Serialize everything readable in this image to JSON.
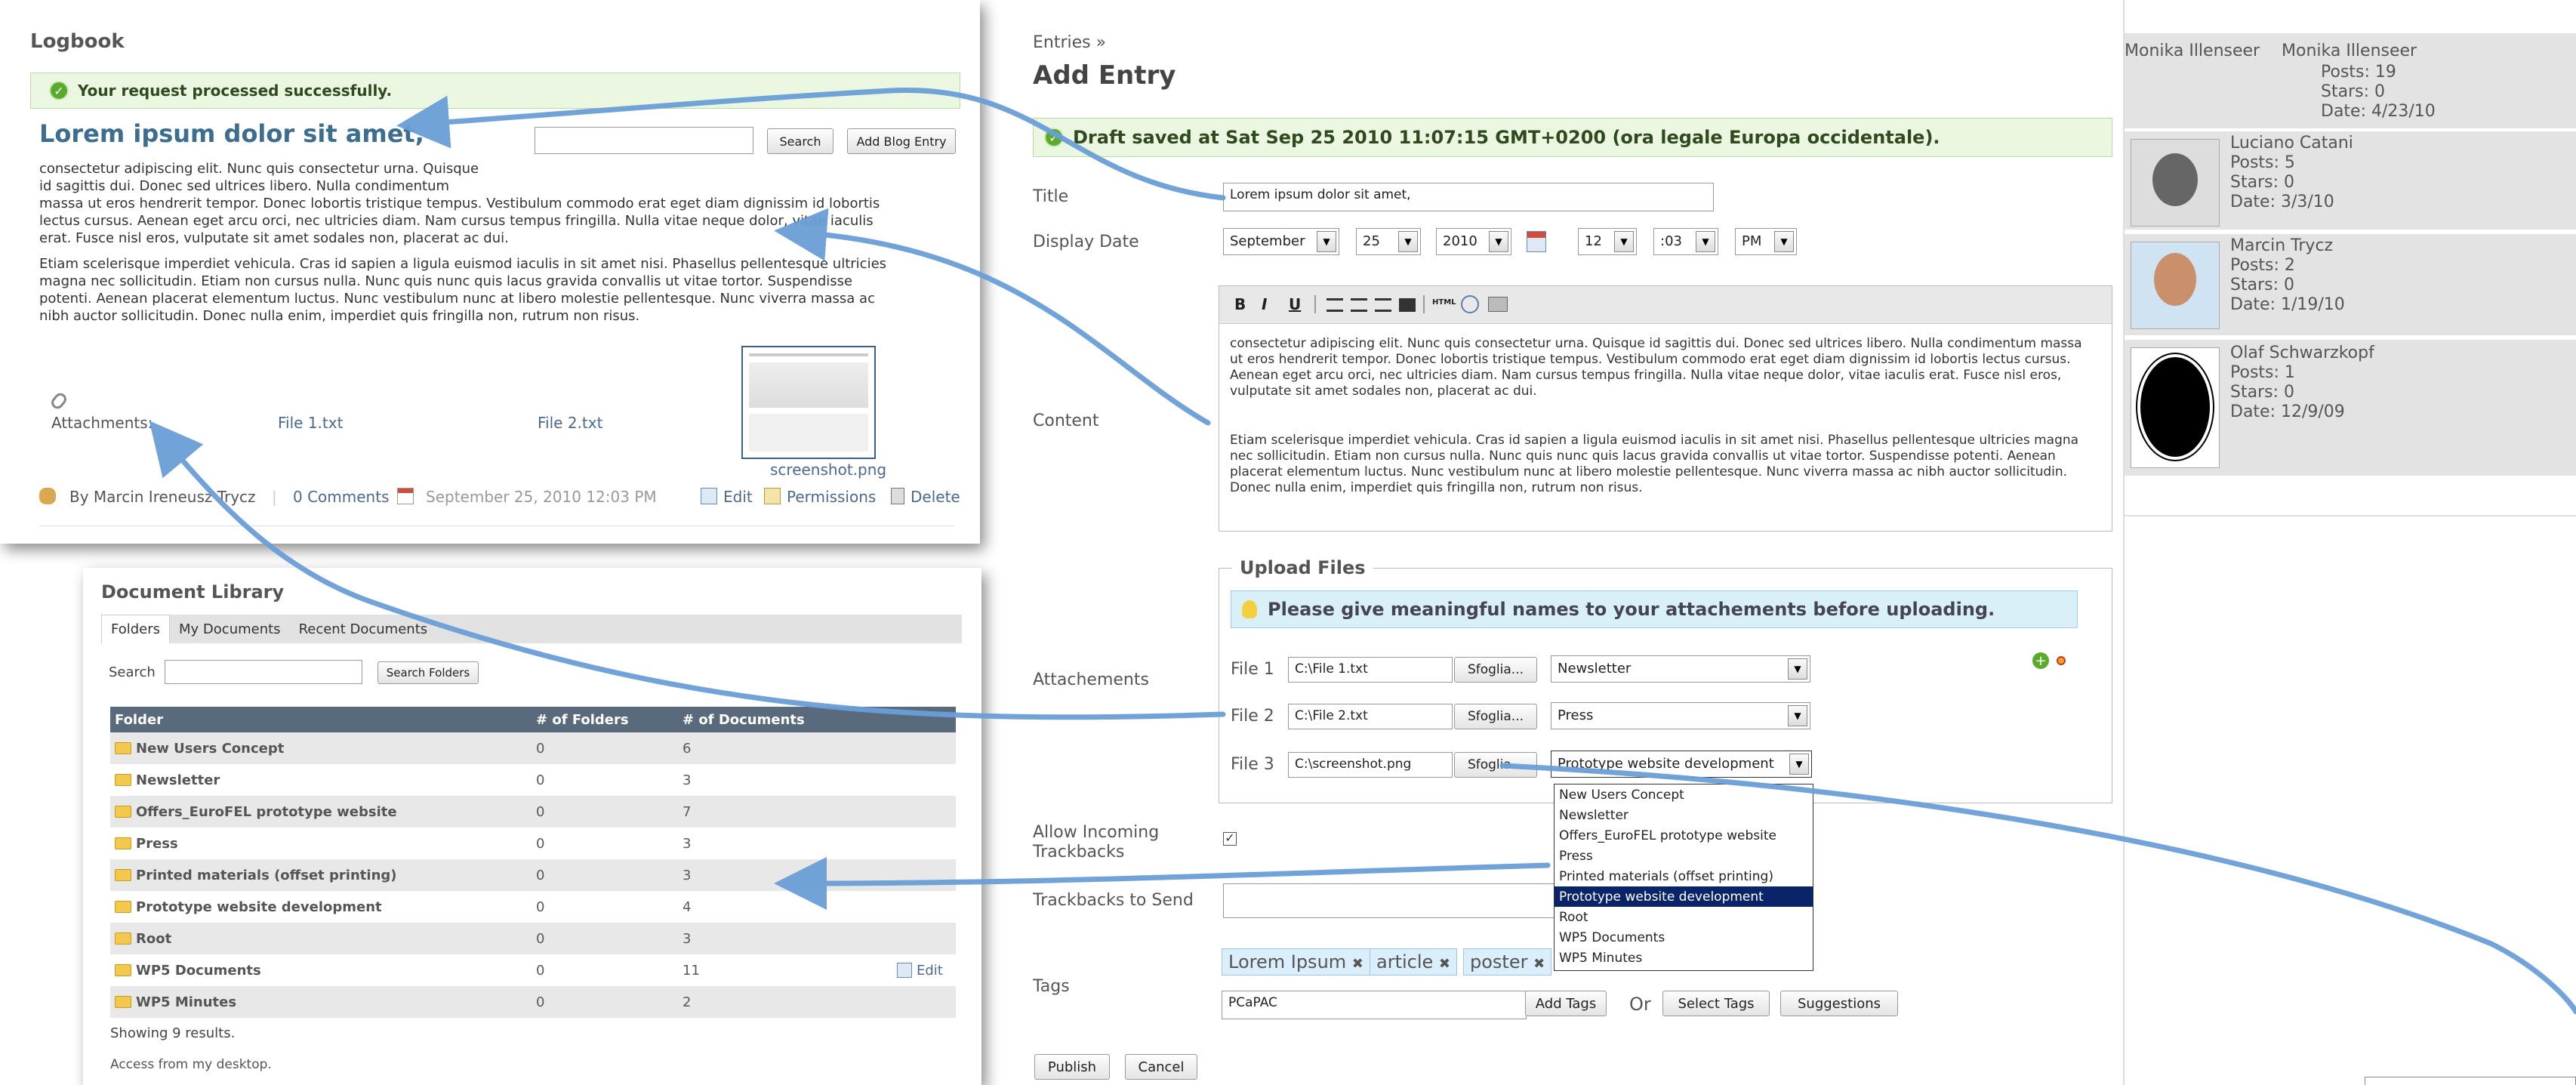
{
  "logbook": {
    "title": "Logbook",
    "success_message": "Your request processed successfully.",
    "post_title": "Lorem ipsum dolor sit amet,",
    "search_button": "Search",
    "add_blog_entry_button": "Add Blog Entry",
    "paragraph1_lines": [
      "consectetur adipiscing elit. Nunc quis consectetur urna. Quisque",
      "id sagittis dui. Donec sed ultrices libero. Nulla condimentum",
      "massa ut eros hendrerit tempor. Donec lobortis tristique tempus. Vestibulum commodo erat eget diam dignissim id lobortis",
      "lectus cursus. Aenean eget arcu orci, nec ultricies diam. Nam cursus tempus fringilla. Nulla vitae neque dolor, vitae iaculis",
      "erat. Fusce nisl eros, vulputate sit amet sodales non, placerat ac dui."
    ],
    "paragraph2_lines": [
      "Etiam scelerisque imperdiet vehicula. Cras id sapien a ligula euismod iaculis in sit amet nisi. Phasellus pellentesque ultricies",
      "magna nec sollicitudin. Etiam non cursus nulla. Nunc quis nunc quis lacus gravida convallis ut vitae tortor. Suspendisse",
      "potenti. Aenean placerat elementum luctus. Nunc vestibulum nunc at libero molestie pellentesque. Nunc viverra massa ac",
      "nibh auctor sollicitudin. Donec nulla enim, imperdiet quis fringilla non, rutrum non risus."
    ],
    "attachments_label": "Attachments:",
    "file1": "File 1.txt",
    "file2": "File 2.txt",
    "screenshot_caption": "screenshot.png",
    "author": "By Marcin Ireneusz Trycz",
    "comments": "0 Comments",
    "date": "September 25, 2010 12:03 PM",
    "edit": "Edit",
    "permissions": "Permissions",
    "delete": "Delete"
  },
  "doclib": {
    "title": "Document Library",
    "tabs": [
      "Folders",
      "My Documents",
      "Recent Documents"
    ],
    "search_label": "Search",
    "search_folders_button": "Search Folders",
    "columns": [
      "Folder",
      "# of Folders",
      "# of Documents"
    ],
    "rows": [
      {
        "name": "New Users Concept",
        "folders": "0",
        "docs": "6"
      },
      {
        "name": "Newsletter",
        "folders": "0",
        "docs": "3"
      },
      {
        "name": "Offers_EuroFEL prototype website",
        "folders": "0",
        "docs": "7"
      },
      {
        "name": "Press",
        "folders": "0",
        "docs": "3"
      },
      {
        "name": "Printed materials (offset printing)",
        "folders": "0",
        "docs": "3"
      },
      {
        "name": "Prototype website development",
        "folders": "0",
        "docs": "4"
      },
      {
        "name": "Root",
        "folders": "0",
        "docs": "3"
      },
      {
        "name": "WP5 Documents",
        "folders": "0",
        "docs": "11"
      },
      {
        "name": "WP5 Minutes",
        "folders": "0",
        "docs": "2"
      }
    ],
    "edit_label": "Edit",
    "showing": "Showing 9 results.",
    "access": "Access from my desktop."
  },
  "entry": {
    "breadcrumb": "Entries »",
    "title": "Add Entry",
    "draft_message": "Draft saved at Sat Sep 25 2010 11:07:15 GMT+0200 (ora legale Europa occidentale).",
    "title_label": "Title",
    "title_value": "Lorem ipsum dolor sit amet,",
    "display_date_label": "Display Date",
    "month": "September",
    "day": "25",
    "year": "2010",
    "hour": "12",
    "minute": ":03",
    "ampm": "PM",
    "toolbar": {
      "bold": "B",
      "italic": "I",
      "underline": "U",
      "html": "HTML"
    },
    "content_label": "Content",
    "content_p1": "consectetur adipiscing elit. Nunc quis consectetur urna. Quisque id sagittis dui. Donec sed ultrices libero. Nulla condimentum massa ut eros hendrerit tempor. Donec lobortis tristique tempus. Vestibulum commodo erat eget diam dignissim id lobortis lectus cursus. Aenean eget arcu orci, nec ultricies diam. Nam cursus tempus fringilla. Nulla vitae neque dolor, vitae iaculis erat. Fusce nisl eros, vulputate sit amet sodales non, placerat ac dui.",
    "content_p2": "Etiam scelerisque imperdiet vehicula. Cras id sapien a ligula euismod iaculis in sit amet nisi. Phasellus pellentesque ultricies magna nec sollicitudin. Etiam non cursus nulla. Nunc quis nunc quis lacus gravida convallis ut vitae tortor. Suspendisse potenti. Aenean placerat elementum luctus. Nunc vestibulum nunc at libero molestie pellentesque. Nunc viverra massa ac nibh auctor sollicitudin. Donec nulla enim, imperdiet quis fringilla non, rutrum non risus.",
    "upload_legend": "Upload Files",
    "upload_hint": "Please give meaningful names to your attachements before uploading.",
    "attachments_label": "Attachements",
    "files": [
      {
        "label": "File 1",
        "path": "C:\\File 1.txt",
        "browse": "Sfoglia...",
        "folder": "Newsletter"
      },
      {
        "label": "File 2",
        "path": "C:\\File 2.txt",
        "browse": "Sfoglia...",
        "folder": "Press"
      },
      {
        "label": "File 3",
        "path": "C:\\screenshot.png",
        "browse": "Sfoglia...",
        "folder": "Prototype website development"
      }
    ],
    "dropdown_options": [
      "New Users Concept",
      "Newsletter",
      "Offers_EuroFEL prototype website",
      "Press",
      "Printed materials (offset printing)",
      "Prototype website development",
      "Root",
      "WP5 Documents",
      "WP5 Minutes"
    ],
    "allow_trackbacks_label_1": "Allow Incoming",
    "allow_trackbacks_label_2": "Trackbacks",
    "trackbacks_send_label": "Trackbacks to Send",
    "tags_label": "Tags",
    "tags": [
      "Lorem Ipsum",
      "article",
      "poster"
    ],
    "tag_input": "PCaPAC",
    "add_tags": "Add Tags",
    "or": "Or",
    "select_tags": "Select Tags",
    "suggestions": "Suggestions",
    "publish": "Publish",
    "cancel": "Cancel"
  },
  "sidebar": {
    "users": [
      {
        "name": "Monika Illenseer",
        "name2": "Monika Illenseer",
        "posts": "Posts: 19",
        "stars": "Stars: 0",
        "date": "Date: 4/23/10"
      },
      {
        "name": "Luciano Catani",
        "posts": "Posts: 5",
        "stars": "Stars: 0",
        "date": "Date: 3/3/10"
      },
      {
        "name": "Marcin Trycz",
        "posts": "Posts: 2",
        "stars": "Stars: 0",
        "date": "Date: 1/19/10"
      },
      {
        "name": "Olaf Schwarzkopf",
        "posts": "Posts: 1",
        "stars": "Stars: 0",
        "date": "Date: 12/9/09"
      }
    ]
  },
  "colors": {
    "arrow": "#6a9fd8",
    "success_bg": "#ecf7e2",
    "table_header": "#596a7d",
    "selected_option": "#0a246a"
  }
}
